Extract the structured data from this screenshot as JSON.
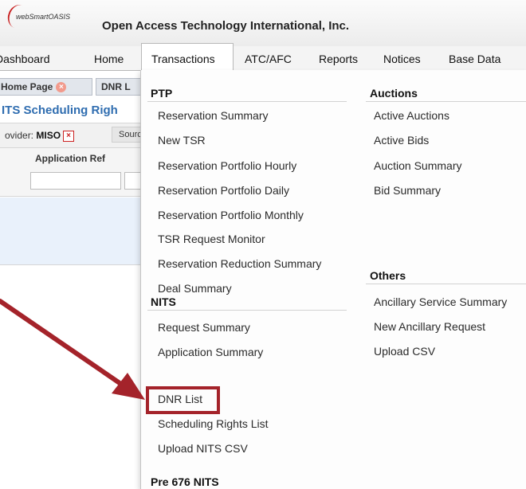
{
  "header": {
    "logo_text": "webSmartOASIS",
    "company": "Open Access Technology International, Inc."
  },
  "nav": {
    "items": [
      "Dashboard",
      "Home",
      "Transactions",
      "ATC/AFC",
      "Reports",
      "Notices",
      "Base Data"
    ],
    "active": "Transactions"
  },
  "underlying": {
    "tab_home": "Home Page",
    "tab_dnr": "DNR L",
    "page_title": "ITS Scheduling Righ",
    "provider_label": "ovider:",
    "provider_value": "MISO",
    "source_label": "Sourc",
    "column_header": "Application Ref"
  },
  "menu": {
    "ptp": {
      "heading": "PTP",
      "items": [
        "Reservation Summary",
        "New TSR",
        "Reservation Portfolio Hourly",
        "Reservation Portfolio Daily",
        "Reservation Portfolio Monthly",
        "TSR Request Monitor",
        "Reservation Reduction Summary",
        "Deal Summary"
      ]
    },
    "nits": {
      "heading": "NITS",
      "items": [
        "Request Summary",
        "Application Summary",
        "DNR List",
        "Scheduling Rights List",
        "Upload NITS CSV"
      ]
    },
    "pre676": {
      "heading": "Pre 676 NITS"
    },
    "auctions": {
      "heading": "Auctions",
      "items": [
        "Active Auctions",
        "Active Bids",
        "Auction Summary",
        "Bid Summary"
      ]
    },
    "others": {
      "heading": "Others",
      "items": [
        "Ancillary Service Summary",
        "New Ancillary Request",
        "Upload CSV"
      ]
    }
  },
  "annotation": {
    "color": "#a4232a",
    "highlighted_item": "DNR List"
  }
}
